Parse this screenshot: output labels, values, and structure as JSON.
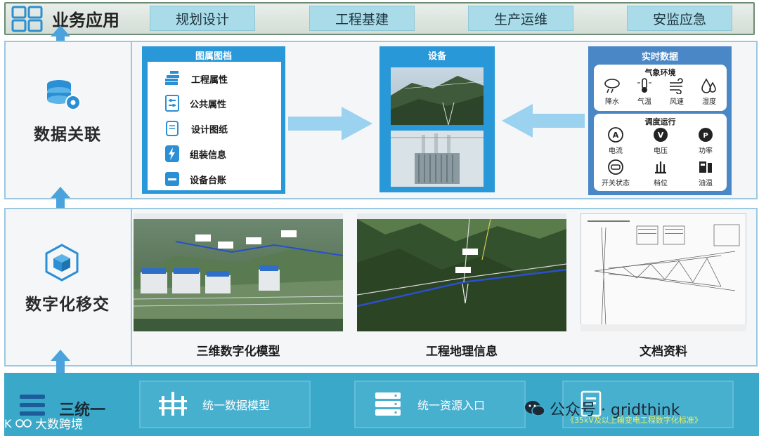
{
  "header": {
    "title": "业务应用",
    "tabs": [
      "规划设计",
      "工程基建",
      "生产运维",
      "安监应急"
    ]
  },
  "rows": {
    "data_link": {
      "label": "数据关联"
    },
    "digital_handover": {
      "label": "数字化移交"
    }
  },
  "archive_panel": {
    "title": "图属图档",
    "items": [
      "工程属性",
      "公共属性",
      "设计图纸",
      "组装信息",
      "设备台账"
    ]
  },
  "device_panel": {
    "title": "设备"
  },
  "realtime_panel": {
    "title": "实时数据",
    "weather": {
      "title": "气象环境",
      "items": [
        "降水",
        "气温",
        "风速",
        "湿度"
      ]
    },
    "dispatch": {
      "title": "调度运行",
      "items": [
        "电流",
        "电压",
        "功率",
        "开关状态",
        "档位",
        "油温"
      ]
    }
  },
  "captions": [
    "三维数字化模型",
    "工程地理信息",
    "文档资料"
  ],
  "bottom": {
    "label": "三统一",
    "boxes": [
      "统一数据模型",
      "统一资源入口"
    ],
    "watermark_left": "大数跨境",
    "watermark_right": "公众号 · gridthink",
    "standard_note": "《35kV及以上输变电工程数字化标准》"
  },
  "colors": {
    "accent_blue": "#2898d8",
    "tab_fill": "#a9dbe8",
    "bottom_fill": "#3aa8c8",
    "panel_border": "#9bc8e0"
  }
}
